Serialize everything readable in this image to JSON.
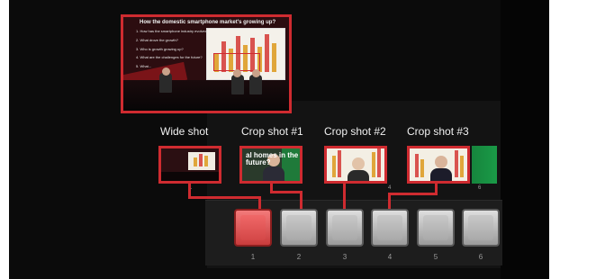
{
  "preview": {
    "title": "How the domestic smartphone market's growing up?",
    "items": [
      "1. How has the smartphone industry evolved?",
      "2. What drove the growth?",
      "3. Who is growth growing up?",
      "4. What are the challenges for the future?",
      "5. What..."
    ]
  },
  "labels": {
    "wide": "Wide shot",
    "crop1": "Crop shot #1",
    "crop2": "Crop shot #2",
    "crop3": "Crop shot #3"
  },
  "thumbnails": [
    {
      "num": "1",
      "caption": ""
    },
    {
      "num": "2",
      "caption": "al homes in the\nfuture?"
    },
    {
      "num": "3",
      "caption": ""
    },
    {
      "num": "4",
      "caption": ""
    },
    {
      "num": "5",
      "caption": ""
    },
    {
      "num": "6",
      "caption": ""
    }
  ],
  "buttons": [
    {
      "num": "1",
      "active": true
    },
    {
      "num": "2",
      "active": false
    },
    {
      "num": "3",
      "active": false
    },
    {
      "num": "4",
      "active": false
    },
    {
      "num": "5",
      "active": false
    },
    {
      "num": "6",
      "active": false
    }
  ],
  "colors": {
    "accent": "#cf2b30",
    "active_button": "#e04848"
  }
}
